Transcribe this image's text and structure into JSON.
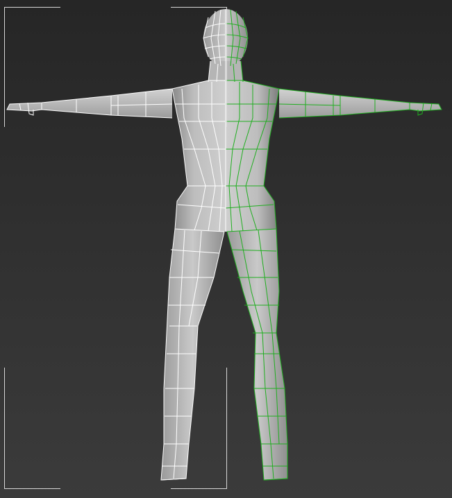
{
  "viewport": {
    "background_top": "#262626",
    "background_bottom": "#3b3b3b",
    "shading": "smooth-highlights-with-edged-faces"
  },
  "model": {
    "pose": "T-pose",
    "mesh_fill": "#b8b8b8",
    "wire_color_left_half": "#ffffff",
    "wire_color_right_half": "#1fae1f",
    "right_half_selected": true
  },
  "selection_brackets": {
    "color": "#d8d8d8"
  }
}
